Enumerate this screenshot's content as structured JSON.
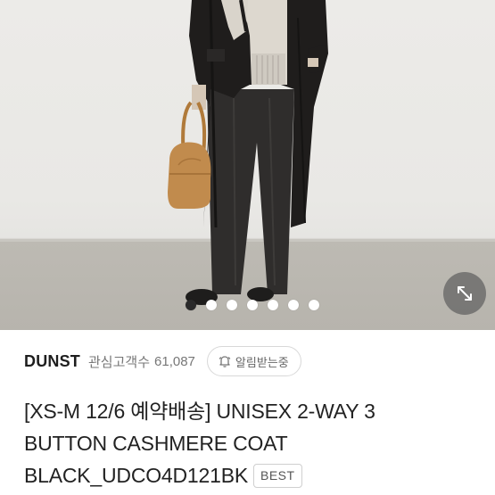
{
  "product_image": {
    "alt": "",
    "carousel": {
      "total": 7,
      "active_index": 0
    },
    "expand_icon": "expand-arrows-icon"
  },
  "brand": {
    "name": "DUNST",
    "fans_label": "관심고객수",
    "fans_count": "61,087",
    "notify_icon": "bell-icon",
    "notify_label": "알림받는중"
  },
  "product": {
    "title_line1": "[XS-M 12/6 예약배송] UNISEX 2-WAY 3",
    "title_line2": "BUTTON CASHMERE COAT",
    "title_line3": "BLACK_UDCO4D121BK",
    "badge": "BEST"
  }
}
